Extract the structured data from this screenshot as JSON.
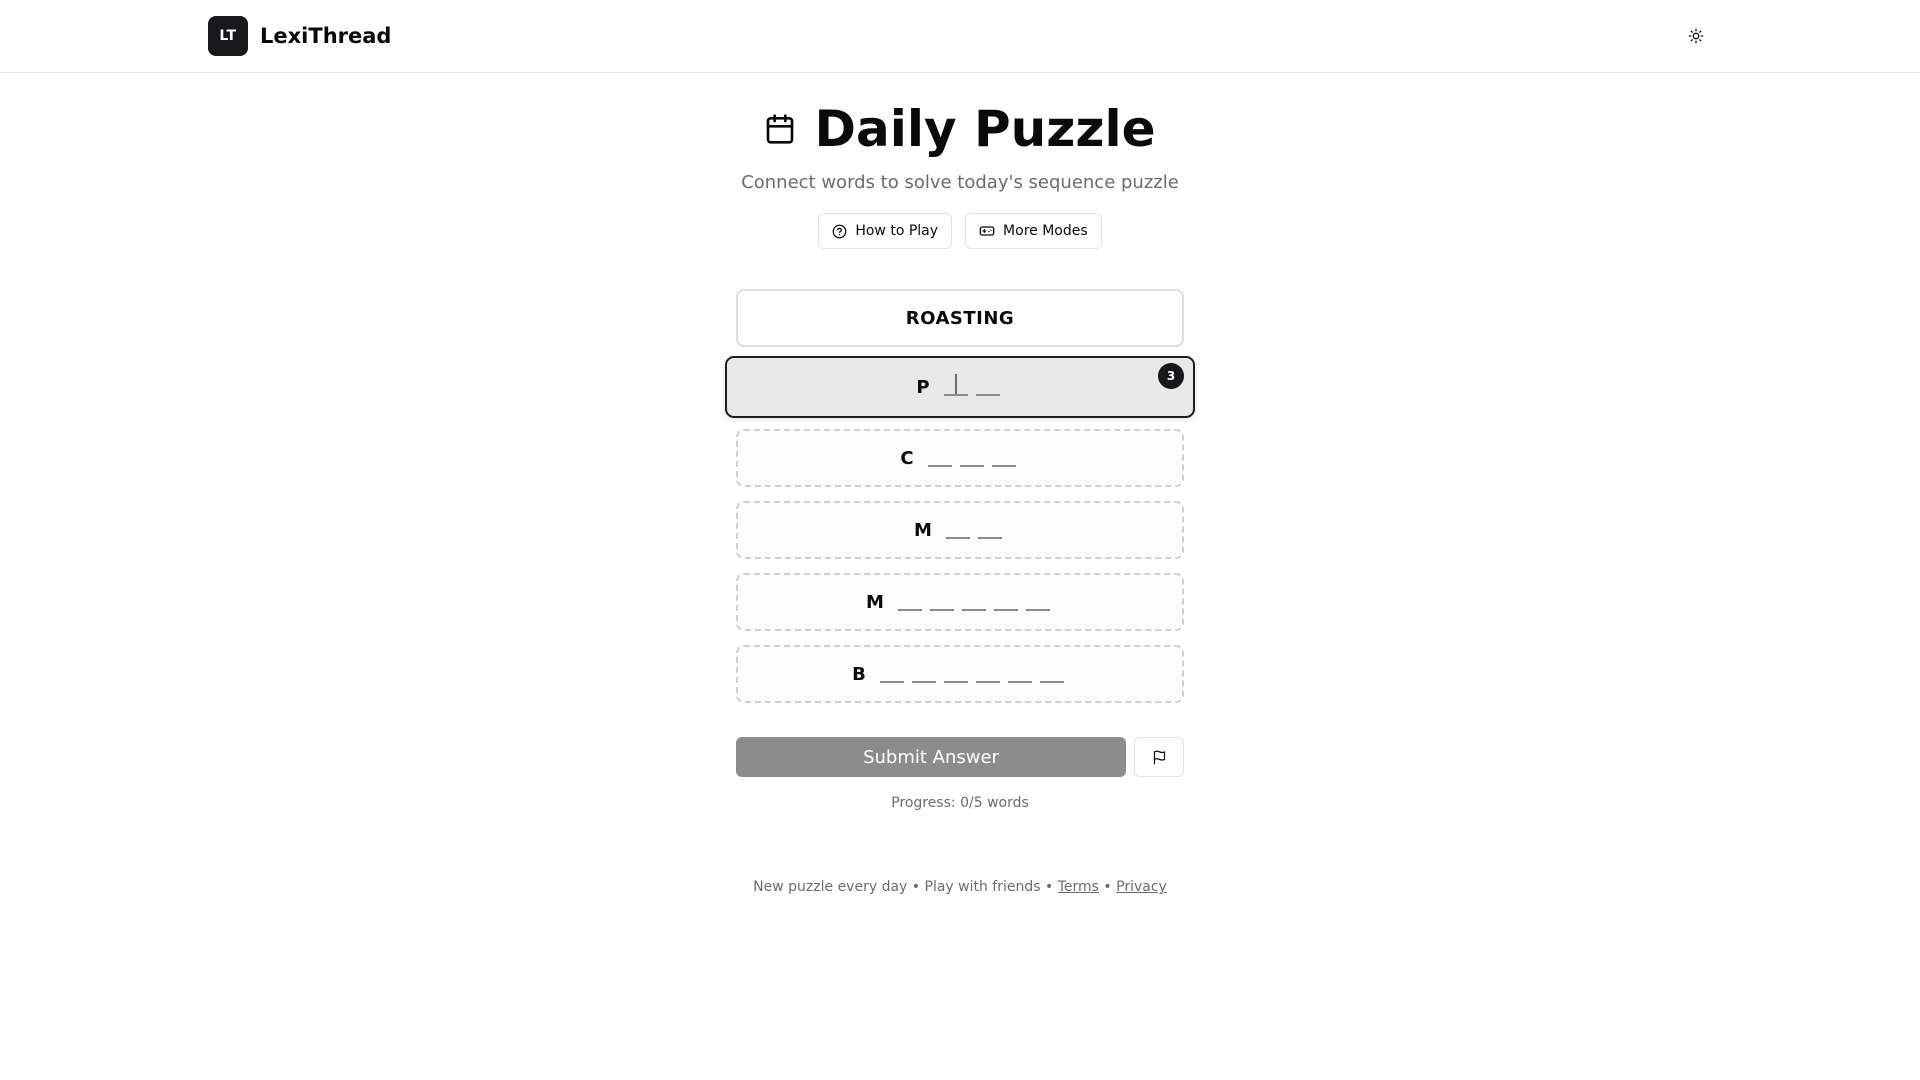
{
  "header": {
    "logo_initials": "LT",
    "app_name": "LexiThread",
    "theme_toggle_icon": "sun-icon"
  },
  "hero": {
    "title_icon": "calendar-icon",
    "title": "Daily Puzzle",
    "subtitle": "Connect words to solve today's sequence puzzle",
    "how_to_play_label": "How to Play",
    "more_modes_label": "More Modes"
  },
  "puzzle": {
    "start_word": "ROASTING",
    "rows": [
      {
        "letter": "P",
        "blanks": 2,
        "active": true,
        "hint_count": "3"
      },
      {
        "letter": "C",
        "blanks": 3,
        "active": false
      },
      {
        "letter": "M",
        "blanks": 2,
        "active": false
      },
      {
        "letter": "M",
        "blanks": 5,
        "active": false
      },
      {
        "letter": "B",
        "blanks": 6,
        "active": false
      }
    ]
  },
  "actions": {
    "submit_label": "Submit Answer",
    "flag_icon": "flag-icon"
  },
  "progress": {
    "text": "Progress: 0/5 words"
  },
  "footer": {
    "text_1": "New puzzle every day",
    "separator": "•",
    "text_2": "Play with friends",
    "terms": "Terms",
    "privacy": "Privacy"
  },
  "colors": {
    "brand_dark": "#18181b",
    "submit_disabled": "#8c8c8c",
    "muted_text": "#6b6b6b",
    "active_row_bg": "#e8e8e8"
  }
}
